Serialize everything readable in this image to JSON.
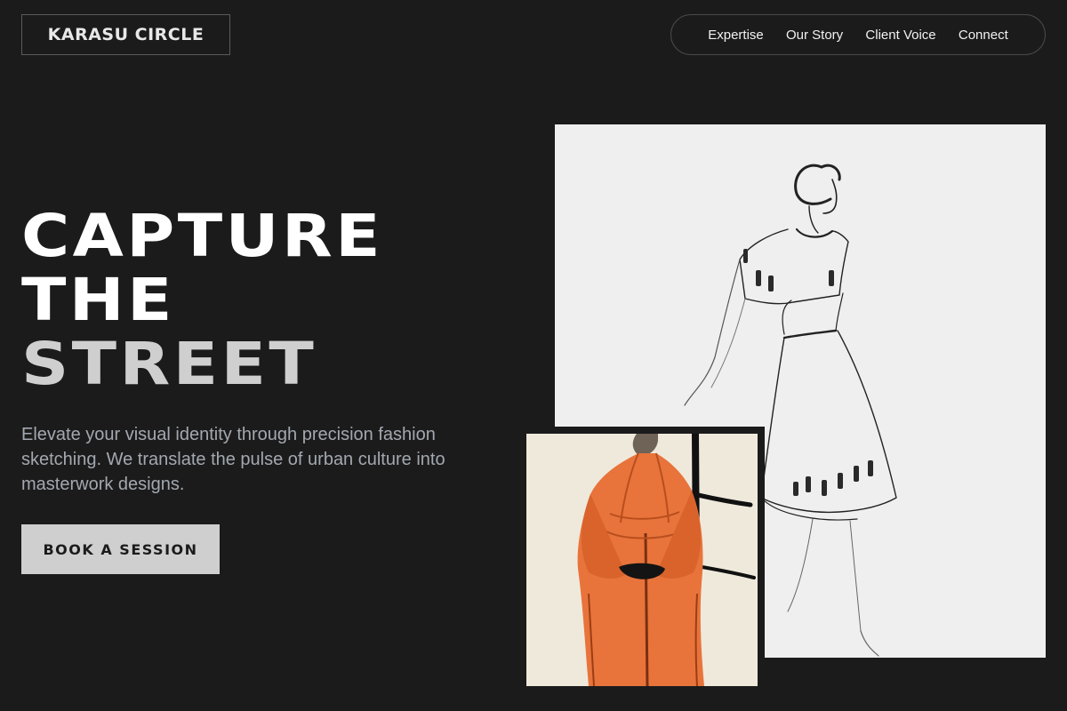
{
  "brand": {
    "logo_text": "KARASU CIRCLE"
  },
  "nav": {
    "items": [
      {
        "label": "Expertise"
      },
      {
        "label": "Our Story"
      },
      {
        "label": "Client Voice"
      },
      {
        "label": "Connect"
      }
    ]
  },
  "hero": {
    "headline_lines": [
      "CAPTURE",
      "THE",
      "STREET"
    ],
    "lead": "Elevate your visual identity through precision fashion sketching. We translate the pulse of urban culture into masterwork designs.",
    "cta_label": "BOOK A SESSION"
  },
  "colors": {
    "background": "#1b1b1b",
    "cta_background": "#cfcfcf",
    "lead_text": "#a3a8b0",
    "coat_accent": "#e8743b"
  },
  "artworks": [
    {
      "name": "dress-sketch-image"
    },
    {
      "name": "orange-coat-sketch-image"
    }
  ]
}
